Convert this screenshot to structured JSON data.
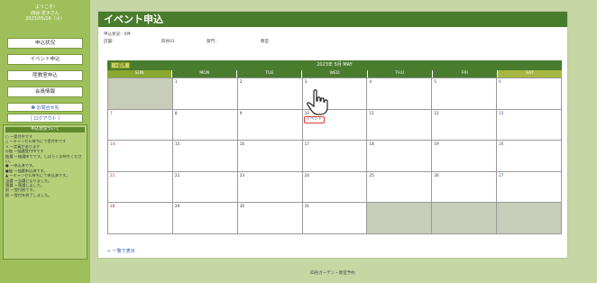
{
  "sidebar": {
    "greet1": "ようこそ!",
    "greet2": "四谷 花子さん",
    "date": "2023/05/26（火）",
    "buttons": [
      "申込状況",
      "イベント申込",
      "陸教室申込",
      "会員情報"
    ],
    "links": [
      "❷ お問合せ先",
      "［ ログアウト ］"
    ],
    "legend_title": "申込状況ついて",
    "legend": [
      "○ ー受付中です",
      "△ ーキャンセル待ちにて受付中です",
      "× ー定員があります",
      "◎抽 ー抽選受付中です",
      "抽選 ー抽選申でです。しばらくお待ちください。",
      "● ー申込済です。",
      "●抽 ー抽選申込済です。",
      "▲ ーキャンセル待ちにて申込済です。",
      "当選 ー当選となりました。",
      "落選 ー落選しました。",
      "前 ー受付前です。",
      "既 ー受付を終了しました。"
    ]
  },
  "main": {
    "title": "イベント申込",
    "status_label": "申込状況：0件",
    "store_label": "店舗：",
    "store_value": "四谷01",
    "dept_label": "部門：",
    "dept_value": "教室",
    "prev_btn": "<前月",
    "month": "2023年 5月 MAY",
    "dow": [
      "SUN",
      "MON",
      "TUE",
      "WED",
      "THU",
      "FRI",
      "SAT"
    ],
    "event_label": "イベント",
    "back_link": "← 一覧で表示"
  },
  "calendar": {
    "weeks": [
      [
        "",
        "1",
        "2",
        "3",
        "4",
        "5",
        "6"
      ],
      [
        "7",
        "8",
        "9",
        "10",
        "11",
        "12",
        "13"
      ],
      [
        "14",
        "15",
        "16",
        "17",
        "18",
        "19",
        "20"
      ],
      [
        "21",
        "22",
        "23",
        "24",
        "25",
        "26",
        "27"
      ],
      [
        "28",
        "29",
        "30",
        "31",
        "",
        "",
        ""
      ]
    ]
  },
  "footer": "四谷ガーデン・教室予約",
  "colors": {
    "header": "#4a7c2e",
    "sidebar": "#9fbf5a",
    "sun_hdr": "#8aa830",
    "sat_hdr": "#a6b843"
  }
}
